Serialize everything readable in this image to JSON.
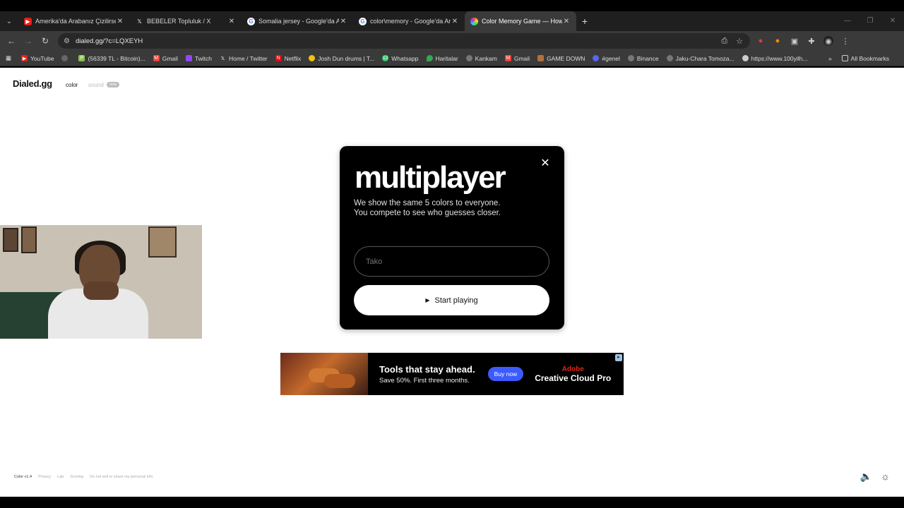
{
  "tabs": [
    {
      "title": "Amerika'da Arabanız Çizilirse N",
      "favicon_color": "#e62117",
      "active": false
    },
    {
      "title": "BEBELER Topluluk / X",
      "favicon_color": "#000000",
      "active": false
    },
    {
      "title": "Somalia jersey - Google'da Ara",
      "favicon_color": "#4285f4",
      "active": false
    },
    {
      "title": "color\\memory - Google'da Ara",
      "favicon_color": "#4285f4",
      "active": false
    },
    {
      "title": "Color Memory Game — How W",
      "favicon_color": "#9b59b6",
      "active": true
    }
  ],
  "address_bar": {
    "url": "dialed.gg/?c=LQXEYH"
  },
  "bookmarks": [
    {
      "label": "YouTube",
      "color": "#e62117"
    },
    {
      "label": "(56339 TL - Bitcoin)...",
      "color": "#8bc34a"
    },
    {
      "label": "Gmail",
      "color": "#ea4335"
    },
    {
      "label": "Twitch",
      "color": "#9146ff"
    },
    {
      "label": "Home / Twitter",
      "color": "#000000"
    },
    {
      "label": "Netflix",
      "color": "#e50914"
    },
    {
      "label": "Josh Dun drums | T...",
      "color": "#f4c20d"
    },
    {
      "label": "Whatsapp",
      "color": "#25d366"
    },
    {
      "label": "Haritalar",
      "color": "#34a853"
    },
    {
      "label": "Kankam",
      "color": "#777777"
    },
    {
      "label": "Gmail",
      "color": "#ea4335"
    },
    {
      "label": "GAME DOWN",
      "color": "#b0713a"
    },
    {
      "label": "#genel",
      "color": "#5865f2"
    },
    {
      "label": "Binance",
      "color": "#777777"
    },
    {
      "label": "Jaku-Chara Tomoza...",
      "color": "#777777"
    },
    {
      "label": "https://www.100yilh...",
      "color": "#cccccc"
    }
  ],
  "all_bookmarks_label": "All Bookmarks",
  "site": {
    "brand": "Dialed.gg",
    "nav_color": "color",
    "nav_sound": "sound",
    "nav_badge": "new"
  },
  "modal": {
    "title": "multiplayer",
    "description_line1": "We show the same 5 colors to everyone.",
    "description_line2": "You compete to see who guesses closer.",
    "name_placeholder": "Tako",
    "start_label": "Start playing"
  },
  "ad": {
    "headline": "Tools that stay ahead.",
    "subline": "Save 50%. First three months.",
    "button": "Buy now",
    "brand_top": "Adobe",
    "brand_bottom": "Creative Cloud Pro"
  },
  "footer": {
    "version": "Color v1.4",
    "links": [
      "Privacy",
      "Lab",
      "Scoring",
      "Do not sell or share my personal info"
    ]
  },
  "colors": {
    "page_bg": "#ffffff",
    "modal_bg": "#000000",
    "accent_ad_button": "#3c5bff"
  }
}
